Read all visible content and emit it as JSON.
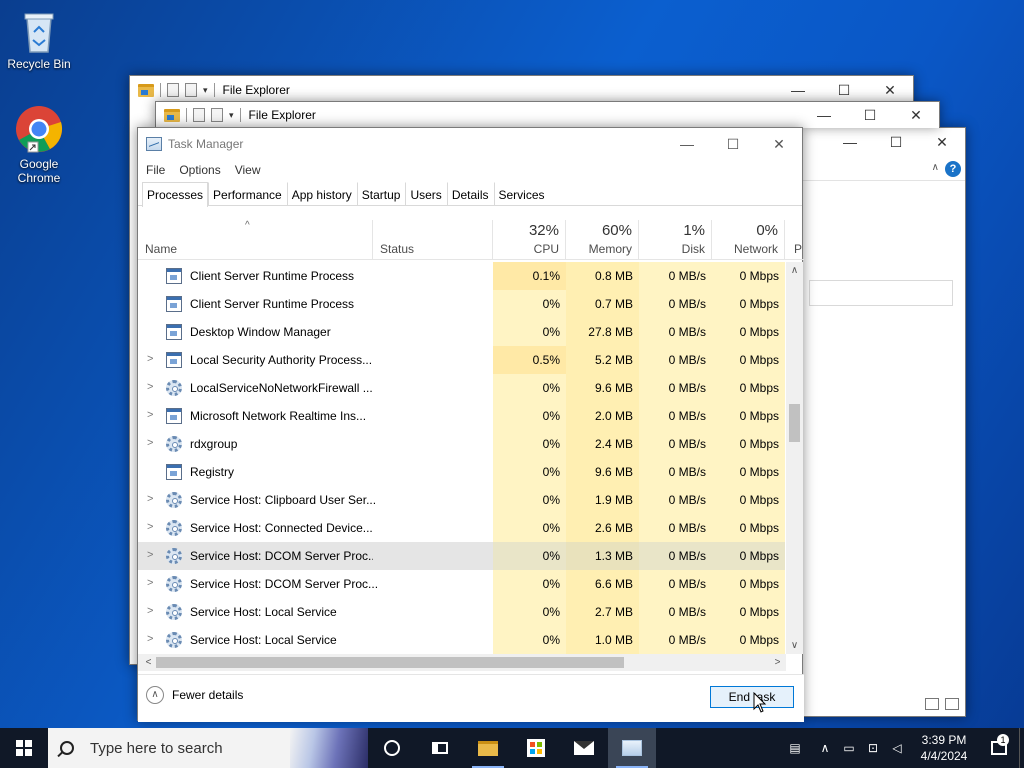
{
  "desktop": {
    "icons": [
      {
        "label": "Recycle Bin",
        "icon": "recycle-bin-icon"
      },
      {
        "label": "Google Chrome",
        "icon": "chrome-icon"
      }
    ]
  },
  "explorer_windows": [
    {
      "title": "File Explorer"
    },
    {
      "title": "File Explorer"
    }
  ],
  "task_manager": {
    "title": "Task Manager",
    "menu": [
      "File",
      "Options",
      "View"
    ],
    "tabs": [
      "Processes",
      "Performance",
      "App history",
      "Startup",
      "Users",
      "Details",
      "Services"
    ],
    "active_tab": "Processes",
    "columns": {
      "name": "Name",
      "status": "Status",
      "cpu": {
        "percent": "32%",
        "label": "CPU"
      },
      "memory": {
        "percent": "60%",
        "label": "Memory"
      },
      "disk": {
        "percent": "1%",
        "label": "Disk"
      },
      "network": {
        "percent": "0%",
        "label": "Network"
      },
      "power_partial": "P"
    },
    "processes": [
      {
        "name": "Client Server Runtime Process",
        "expandable": false,
        "icon": "app-icon",
        "cpu": "0.1%",
        "memory": "0.8 MB",
        "disk": "0 MB/s",
        "network": "0 Mbps"
      },
      {
        "name": "Client Server Runtime Process",
        "expandable": false,
        "icon": "app-icon",
        "cpu": "0%",
        "memory": "0.7 MB",
        "disk": "0 MB/s",
        "network": "0 Mbps"
      },
      {
        "name": "Desktop Window Manager",
        "expandable": false,
        "icon": "app-icon",
        "cpu": "0%",
        "memory": "27.8 MB",
        "disk": "0 MB/s",
        "network": "0 Mbps"
      },
      {
        "name": "Local Security Authority Process...",
        "expandable": true,
        "icon": "app-icon",
        "cpu": "0.5%",
        "memory": "5.2 MB",
        "disk": "0 MB/s",
        "network": "0 Mbps"
      },
      {
        "name": "LocalServiceNoNetworkFirewall ...",
        "expandable": true,
        "icon": "gear-icon",
        "cpu": "0%",
        "memory": "9.6 MB",
        "disk": "0 MB/s",
        "network": "0 Mbps"
      },
      {
        "name": "Microsoft Network Realtime Ins...",
        "expandable": true,
        "icon": "app-icon",
        "cpu": "0%",
        "memory": "2.0 MB",
        "disk": "0 MB/s",
        "network": "0 Mbps"
      },
      {
        "name": "rdxgroup",
        "expandable": true,
        "icon": "gear-icon",
        "cpu": "0%",
        "memory": "2.4 MB",
        "disk": "0 MB/s",
        "network": "0 Mbps"
      },
      {
        "name": "Registry",
        "expandable": false,
        "icon": "app-icon",
        "cpu": "0%",
        "memory": "9.6 MB",
        "disk": "0 MB/s",
        "network": "0 Mbps"
      },
      {
        "name": "Service Host: Clipboard User Ser...",
        "expandable": true,
        "icon": "gear-icon",
        "cpu": "0%",
        "memory": "1.9 MB",
        "disk": "0 MB/s",
        "network": "0 Mbps"
      },
      {
        "name": "Service Host: Connected Device...",
        "expandable": true,
        "icon": "gear-icon",
        "cpu": "0%",
        "memory": "2.6 MB",
        "disk": "0 MB/s",
        "network": "0 Mbps"
      },
      {
        "name": "Service Host: DCOM Server Proc...",
        "expandable": true,
        "icon": "gear-icon",
        "cpu": "0%",
        "memory": "1.3 MB",
        "disk": "0 MB/s",
        "network": "0 Mbps",
        "selected": true
      },
      {
        "name": "Service Host: DCOM Server Proc...",
        "expandable": true,
        "icon": "gear-icon",
        "cpu": "0%",
        "memory": "6.6 MB",
        "disk": "0 MB/s",
        "network": "0 Mbps"
      },
      {
        "name": "Service Host: Local Service",
        "expandable": true,
        "icon": "gear-icon",
        "cpu": "0%",
        "memory": "2.7 MB",
        "disk": "0 MB/s",
        "network": "0 Mbps"
      },
      {
        "name": "Service Host: Local Service",
        "expandable": true,
        "icon": "gear-icon",
        "cpu": "0%",
        "memory": "1.0 MB",
        "disk": "0 MB/s",
        "network": "0 Mbps"
      }
    ],
    "footer": {
      "fewer_details": "Fewer details",
      "end_task": "End task"
    }
  },
  "taskbar": {
    "search_placeholder": "Type here to search",
    "pinned": [
      "cortana-icon",
      "task-view-icon",
      "file-explorer-icon",
      "store-icon",
      "mail-icon",
      "task-manager-icon"
    ],
    "clock_time": "3:39 PM",
    "clock_date": "4/4/2024",
    "notification_count": "1"
  },
  "colors": {
    "accent": "#0078d7",
    "heat_light": "#fff4c4",
    "heat_medium": "#ffefb2",
    "taskbar": "#101827"
  }
}
